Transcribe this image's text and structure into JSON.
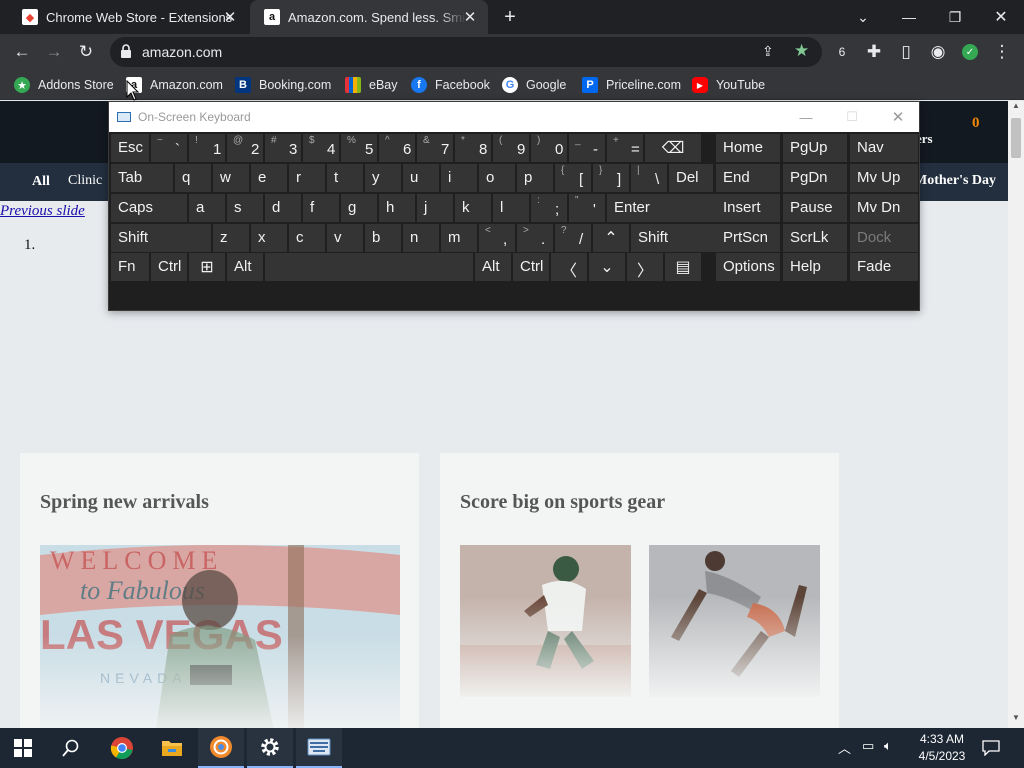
{
  "browser": {
    "tabs": [
      {
        "title": "Chrome Web Store - Extensions",
        "active": false,
        "favicon": "chrome-web-store-icon"
      },
      {
        "title": "Amazon.com. Spend less. Smile more.",
        "active": true,
        "favicon": "amazon-icon"
      }
    ],
    "url": "amazon.com",
    "bookmarks": [
      {
        "label": "Addons Store",
        "icon": "addons-store-icon",
        "color": "#34a853"
      },
      {
        "label": "Amazon.com",
        "icon": "amazon-icon",
        "color": "#ffffff"
      },
      {
        "label": "Booking.com",
        "icon": "booking-icon",
        "color": "#003580"
      },
      {
        "label": "eBay",
        "icon": "ebay-icon",
        "color": "#e53238"
      },
      {
        "label": "Facebook",
        "icon": "facebook-icon",
        "color": "#1877f2"
      },
      {
        "label": "Google",
        "icon": "google-icon",
        "color": "#ffffff"
      },
      {
        "label": "Priceline.com",
        "icon": "priceline-icon",
        "color": "#0068ef"
      },
      {
        "label": "YouTube",
        "icon": "youtube-icon",
        "color": "#ff0000"
      }
    ]
  },
  "page": {
    "cart_count": "0",
    "header_right_fragment": "ers",
    "nav": {
      "all": "All",
      "clinic": "Clinic",
      "right_item": "Mother's Day"
    },
    "previous_slide": "Previous slide",
    "list_marker": "1.",
    "cards": [
      {
        "title": "Spring new arrivals"
      },
      {
        "title": "Score big on sports gear"
      }
    ]
  },
  "osk": {
    "title": "On-Screen Keyboard",
    "rows": [
      [
        {
          "main": "Esc"
        },
        {
          "shift": "~",
          "base": "`"
        },
        {
          "shift": "!",
          "base": "1"
        },
        {
          "shift": "@",
          "base": "2"
        },
        {
          "shift": "#",
          "base": "3"
        },
        {
          "shift": "$",
          "base": "4"
        },
        {
          "shift": "%",
          "base": "5"
        },
        {
          "shift": "^",
          "base": "6"
        },
        {
          "shift": "&",
          "base": "7"
        },
        {
          "shift": "*",
          "base": "8"
        },
        {
          "shift": "(",
          "base": "9"
        },
        {
          "shift": ")",
          "base": "0"
        },
        {
          "shift": "_",
          "base": "-"
        },
        {
          "shift": "+",
          "base": "="
        },
        {
          "icon": "⌫",
          "name": "backspace"
        }
      ],
      [
        {
          "main": "Tab"
        },
        {
          "main": "q"
        },
        {
          "main": "w"
        },
        {
          "main": "e"
        },
        {
          "main": "r"
        },
        {
          "main": "t"
        },
        {
          "main": "y"
        },
        {
          "main": "u"
        },
        {
          "main": "i"
        },
        {
          "main": "o"
        },
        {
          "main": "p"
        },
        {
          "shift": "{",
          "base": "["
        },
        {
          "shift": "}",
          "base": "]"
        },
        {
          "shift": "|",
          "base": "\\"
        },
        {
          "main": "Del"
        }
      ],
      [
        {
          "main": "Caps"
        },
        {
          "main": "a"
        },
        {
          "main": "s"
        },
        {
          "main": "d"
        },
        {
          "main": "f"
        },
        {
          "main": "g"
        },
        {
          "main": "h"
        },
        {
          "main": "j"
        },
        {
          "main": "k"
        },
        {
          "main": "l"
        },
        {
          "shift": ":",
          "base": ";"
        },
        {
          "shift": "\"",
          "base": "'"
        },
        {
          "main": "Enter"
        }
      ],
      [
        {
          "main": "Shift"
        },
        {
          "main": "z"
        },
        {
          "main": "x"
        },
        {
          "main": "c"
        },
        {
          "main": "v"
        },
        {
          "main": "b"
        },
        {
          "main": "n"
        },
        {
          "main": "m"
        },
        {
          "shift": "<",
          "base": ","
        },
        {
          "shift": ">",
          "base": "."
        },
        {
          "shift": "?",
          "base": "/"
        },
        {
          "icon": "⌃",
          "name": "arrow-up"
        },
        {
          "main": "Shift"
        }
      ],
      [
        {
          "main": "Fn"
        },
        {
          "main": "Ctrl"
        },
        {
          "icon": "⊞",
          "name": "windows"
        },
        {
          "main": "Alt"
        },
        {
          "main": "",
          "name": "space"
        },
        {
          "main": "Alt"
        },
        {
          "main": "Ctrl"
        },
        {
          "icon": "〈",
          "name": "arrow-left"
        },
        {
          "icon": "⌄",
          "name": "arrow-down"
        },
        {
          "icon": "〉",
          "name": "arrow-right"
        },
        {
          "icon": "▤",
          "name": "menu"
        }
      ]
    ],
    "nav_keys": [
      [
        "Home",
        "PgUp",
        "Nav"
      ],
      [
        "End",
        "PgDn",
        "Mv Up"
      ],
      [
        "Insert",
        "Pause",
        "Mv Dn"
      ],
      [
        "PrtScn",
        "ScrLk",
        "Dock"
      ],
      [
        "Options",
        "Help",
        "Fade"
      ]
    ]
  },
  "taskbar": {
    "time": "4:33 AM",
    "date": "4/5/2023",
    "apps": [
      "start-icon",
      "search-icon",
      "chrome-icon",
      "file-explorer-icon",
      "brave-icon",
      "settings-icon",
      "on-screen-keyboard-icon"
    ]
  }
}
